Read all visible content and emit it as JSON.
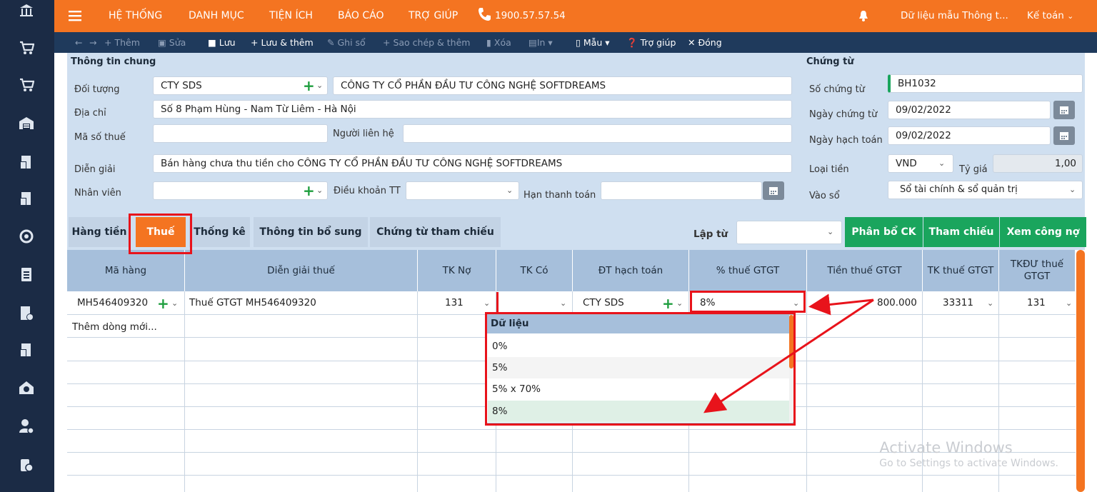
{
  "sidebar": {
    "icons": [
      "bank-icon",
      "cart-in-icon",
      "cart-out-icon",
      "warehouse-icon",
      "invoice-icon",
      "invoice2-icon",
      "tool-icon",
      "document-icon",
      "receipt-icon",
      "invoice3-icon",
      "home-money-icon",
      "person-money-icon",
      "money-bag-icon"
    ]
  },
  "topbar": {
    "menu": [
      "HỆ THỐNG",
      "DANH MỤC",
      "TIỆN ÍCH",
      "BÁO CÁO",
      "TRỢ GIÚP"
    ],
    "phone": "1900.57.57.54",
    "company": "Dữ liệu mẫu Thông t...",
    "user": "Kế toán"
  },
  "toolbar": {
    "add": "+ Thêm",
    "edit": "Sửa",
    "save": "Lưu",
    "save_add": "+ Lưu & thêm",
    "post": "Ghi sổ",
    "copy_add": "+ Sao chép & thêm",
    "delete": "Xóa",
    "print": "In",
    "template": "Mẫu",
    "help": "Trợ giúp",
    "close": "Đóng"
  },
  "general": {
    "section": "Thông tin chung",
    "doituong_label": "Đối tượng",
    "doituong_value": "CTY SDS",
    "doituong_name": "CÔNG TY CỔ PHẦN ĐẦU TƯ CÔNG NGHỆ SOFTDREAMS",
    "diachi_label": "Địa chỉ",
    "diachi_value": "Số 8 Phạm Hùng - Nam Từ Liêm - Hà Nội",
    "mst_label": "Mã số thuế",
    "mst_value": "",
    "nguoilienhe_label": "Người liên hệ",
    "nguoilienhe_value": "",
    "diengiai_label": "Diễn giải",
    "diengiai_value": "Bán hàng chưa thu tiền cho CÔNG TY CỔ PHẦN ĐẦU TƯ CÔNG NGHỆ SOFTDREAMS",
    "nhanvien_label": "Nhân viên",
    "dieukhoan_label": "Điều khoản TT",
    "hanthanhtoan_label": "Hạn thanh toán"
  },
  "voucher": {
    "section": "Chứng từ",
    "so_label": "Số chứng từ",
    "so_value": "BH1032",
    "ngayct_label": "Ngày chứng từ",
    "ngayct_value": "09/02/2022",
    "ngayht_label": "Ngày hạch toán",
    "ngayht_value": "09/02/2022",
    "loaitien_label": "Loại tiền",
    "loaitien_value": "VND",
    "tygia_label": "Tỷ giá",
    "tygia_value": "1,00",
    "vaoso_label": "Vào sổ",
    "vaoso_value": "Sổ tài chính & sổ quản trị"
  },
  "tabs": [
    "Hàng tiền",
    "Thuế",
    "Thống kê",
    "Thông tin bổ sung",
    "Chứng từ tham chiếu"
  ],
  "lap_tu_label": "Lập từ",
  "actions": [
    "Phân bổ CK",
    "Tham chiếu",
    "Xem công nợ"
  ],
  "table": {
    "headers": [
      "Mã hàng",
      "Diễn giải thuế",
      "TK Nợ",
      "TK Có",
      "ĐT hạch toán",
      "% thuế GTGT",
      "Tiền thuế GTGT",
      "TK thuế GTGT",
      "TKĐƯ thuế GTGT"
    ],
    "row": {
      "ma_hang": "MH546409320",
      "dien_giai": "Thuế GTGT MH546409320",
      "tk_no": "131",
      "tk_co": "",
      "dt_hach_toan": "CTY SDS",
      "pct_thue": "8%",
      "tien_thue": "800.000",
      "tk_thue": "33311",
      "tkdu_thue": "131"
    },
    "add_row": "Thêm dòng mới..."
  },
  "dropdown": {
    "header": "Dữ liệu",
    "options": [
      "0%",
      "5%",
      "5% x 70%",
      "8%"
    ],
    "selected": "8%"
  },
  "watermark": {
    "line1": "Activate Windows",
    "line2": "Go to Settings to activate Windows."
  },
  "colors": {
    "orange": "#f47421",
    "navy": "#1b2b45",
    "green": "#1aa55d",
    "red": "#e8131b"
  }
}
